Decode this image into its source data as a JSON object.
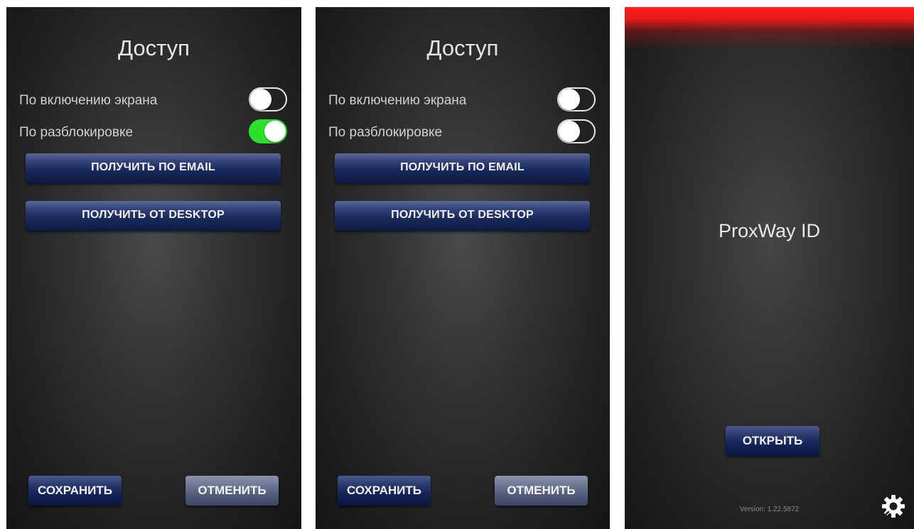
{
  "screen1": {
    "title": "Доступ",
    "settings": [
      {
        "label": "По включению экрана",
        "state": "off"
      },
      {
        "label": "По разблокировке",
        "state": "on"
      }
    ],
    "email_button": "ПОЛУЧИТЬ ПО EMAIL",
    "desktop_button": "ПОЛУЧИТЬ ОТ DESKTOP",
    "save_button": "СОХРАНИТЬ",
    "cancel_button": "ОТМЕНИТЬ"
  },
  "screen2": {
    "title": "Доступ",
    "settings": [
      {
        "label": "По включению экрана",
        "state": "off"
      },
      {
        "label": "По разблокировке",
        "state": "off"
      }
    ],
    "email_button": "ПОЛУЧИТЬ ПО EMAIL",
    "desktop_button": "ПОЛУЧИТЬ ОТ DESKTOP",
    "save_button": "СОХРАНИТЬ",
    "cancel_button": "ОТМЕНИТЬ"
  },
  "screen3": {
    "app_name": "ProxWay ID",
    "open_button": "ОТКРЫТЬ",
    "version": "Version: 1.22.5872",
    "settings_icon": "gear-icon",
    "status_bar_color": "#ff1f1f"
  },
  "colors": {
    "toggle_on": "#2ee02e",
    "button_navy": "#142458",
    "button_grey": "#6c7592",
    "background": "#2a2a2a"
  }
}
